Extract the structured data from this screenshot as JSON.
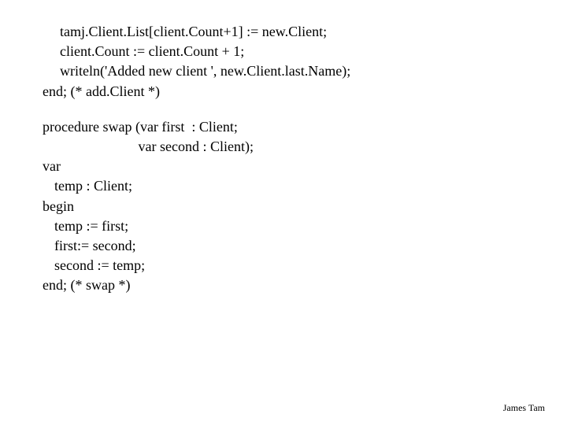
{
  "code": {
    "l1": "tamj.Client.List[client.Count+1] := new.Client;",
    "l2": "client.Count := client.Count + 1;",
    "l3": "writeln('Added new client ', new.Client.last.Name);",
    "l4": "end; (* add.Client *)",
    "l5": "procedure swap (var first  : Client;",
    "l6": "                           var second : Client);",
    "l7": "var",
    "l8": "temp : Client;",
    "l9": "begin",
    "l10": "temp := first;",
    "l11": "first:= second;",
    "l12": "second := temp;",
    "l13": "end; (* swap *)"
  },
  "footer": "James Tam"
}
